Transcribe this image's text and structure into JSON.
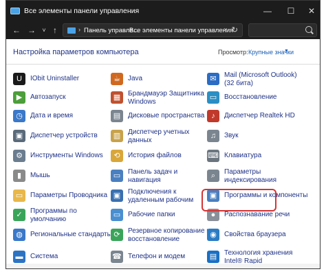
{
  "window": {
    "title": "Все элементы панели управления",
    "minimize_glyph": "—",
    "maximize_glyph": "☐",
    "close_glyph": "✕"
  },
  "nav": {
    "back_glyph": "←",
    "forward_glyph": "→",
    "recent_glyph": "˅",
    "up_glyph": "↑",
    "address_crumbs": [
      "Панель управле...",
      "Все элементы панели управления"
    ],
    "crumb_separator": "›",
    "address_dropdown_glyph": "˅",
    "refresh_glyph": "↻",
    "search_placeholder": ""
  },
  "content": {
    "title": "Настройка параметров компьютера",
    "view_by_label": "Просмотр:",
    "view_by_value": "Крупные значки",
    "view_by_caret": "▼"
  },
  "items": [
    {
      "col": 1,
      "row": 0,
      "label": "IObit Uninstaller",
      "icon": "iobit-uninstaller-icon",
      "glyph": "U",
      "color": "#1a1a1a"
    },
    {
      "col": 1,
      "row": 1,
      "label": "Автозапуск",
      "icon": "autoplay-icon",
      "glyph": "▶",
      "color": "#4c9f3a"
    },
    {
      "col": 1,
      "row": 2,
      "label": "Дата и время",
      "icon": "date-time-icon",
      "glyph": "◷",
      "color": "#3a78c9"
    },
    {
      "col": 1,
      "row": 3,
      "label": "Диспетчер устройств",
      "icon": "device-manager-icon",
      "glyph": "▣",
      "color": "#5a6a7a"
    },
    {
      "col": 1,
      "row": 4,
      "label": "Инструменты Windows",
      "icon": "windows-tools-icon",
      "glyph": "⚙",
      "color": "#6b7d8f"
    },
    {
      "col": 1,
      "row": 5,
      "label": "Мышь",
      "icon": "mouse-icon",
      "glyph": "▮",
      "color": "#8a8a8a"
    },
    {
      "col": 1,
      "row": 6,
      "label": "Параметры Проводника",
      "icon": "explorer-options-icon",
      "glyph": "▭",
      "color": "#e8b84a"
    },
    {
      "col": 1,
      "row": 7,
      "label": "Программы по умолчанию",
      "icon": "default-programs-icon",
      "glyph": "✓",
      "color": "#3aa55a"
    },
    {
      "col": 1,
      "row": 8,
      "label": "Региональные стандарты",
      "icon": "region-icon",
      "glyph": "◍",
      "color": "#3a78c9"
    },
    {
      "col": 1,
      "row": 9,
      "label": "Система",
      "icon": "system-icon",
      "glyph": "▬",
      "color": "#2c73c4"
    },
    {
      "col": 2,
      "row": 0,
      "label": "Java",
      "icon": "java-icon",
      "glyph": "☕",
      "color": "#d0691f"
    },
    {
      "col": 2,
      "row": 1,
      "label": "Брандмауэр Защитника Windows",
      "icon": "firewall-icon",
      "glyph": "▦",
      "color": "#c0502e"
    },
    {
      "col": 2,
      "row": 2,
      "label": "Дисковые пространства",
      "icon": "storage-spaces-icon",
      "glyph": "▤",
      "color": "#7a8590"
    },
    {
      "col": 2,
      "row": 3,
      "label": "Диспетчер учетных данных",
      "icon": "credential-manager-icon",
      "glyph": "▥",
      "color": "#c8a24a"
    },
    {
      "col": 2,
      "row": 4,
      "label": "История файлов",
      "icon": "file-history-icon",
      "glyph": "⟲",
      "color": "#d9a63a"
    },
    {
      "col": 2,
      "row": 5,
      "label": "Панель задач и навигация",
      "icon": "taskbar-icon",
      "glyph": "▭",
      "color": "#4a7fc0"
    },
    {
      "col": 2,
      "row": 6,
      "label": "Подключения к удаленным рабочим",
      "icon": "remote-desktop-icon",
      "glyph": "▣",
      "color": "#3a6fb0"
    },
    {
      "col": 2,
      "row": 7,
      "label": "Рабочие папки",
      "icon": "work-folders-icon",
      "glyph": "▭",
      "color": "#4a8fd0"
    },
    {
      "col": 2,
      "row": 8,
      "label": "Резервное копирование и восстановление",
      "icon": "backup-icon",
      "glyph": "⟳",
      "color": "#3aa55a"
    },
    {
      "col": 2,
      "row": 9,
      "label": "Телефон и модем",
      "icon": "phone-modem-icon",
      "glyph": "☎",
      "color": "#7a8590"
    },
    {
      "col": 3,
      "row": 0,
      "label": "Mail (Microsoft Outlook) (32 бита)",
      "icon": "mail-icon",
      "glyph": "✉",
      "color": "#2b6cc4"
    },
    {
      "col": 3,
      "row": 1,
      "label": "Восстановление",
      "icon": "recovery-icon",
      "glyph": "▭",
      "color": "#2b8fc4"
    },
    {
      "col": 3,
      "row": 2,
      "label": "Диспетчер Realtek HD",
      "icon": "realtek-icon",
      "glyph": "♪",
      "color": "#c0392b"
    },
    {
      "col": 3,
      "row": 3,
      "label": "Звук",
      "icon": "sound-icon",
      "glyph": "♫",
      "color": "#7a8590"
    },
    {
      "col": 3,
      "row": 4,
      "label": "Клавиатура",
      "icon": "keyboard-icon",
      "glyph": "⌨",
      "color": "#6a7580"
    },
    {
      "col": 3,
      "row": 5,
      "label": "Параметры индексирования",
      "icon": "indexing-icon",
      "glyph": "⌕",
      "color": "#7a8590"
    },
    {
      "col": 3,
      "row": 6,
      "label": "Программы и компоненты",
      "icon": "programs-features-icon",
      "glyph": "▣",
      "color": "#4a7fc0"
    },
    {
      "col": 3,
      "row": 7,
      "label": "Распознавание речи",
      "icon": "speech-recognition-icon",
      "glyph": "●",
      "color": "#8a9099"
    },
    {
      "col": 3,
      "row": 8,
      "label": "Свойства браузера",
      "icon": "internet-options-icon",
      "glyph": "◉",
      "color": "#2b7cc4"
    },
    {
      "col": 3,
      "row": 9,
      "label": "Технология хранения Intel® Rapid",
      "icon": "intel-rst-icon",
      "glyph": "▤",
      "color": "#1a6fc4"
    }
  ]
}
